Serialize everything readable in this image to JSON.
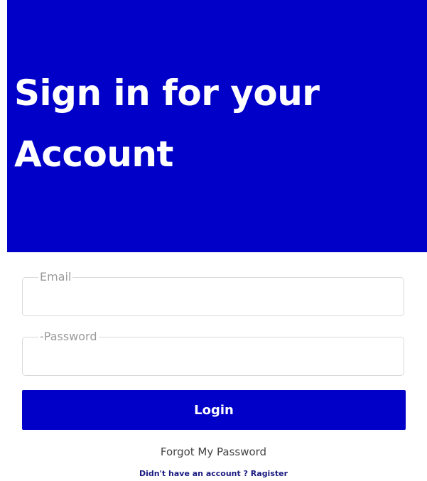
{
  "header": {
    "title_line1": "Sign in for your",
    "title_line2": "Account"
  },
  "form": {
    "email_label": "Email",
    "email_value": "",
    "password_label": "-Password",
    "password_value": "",
    "login_label": "Login"
  },
  "links": {
    "forgot_password": "Forgot My Password",
    "register": "Didn't have an account ? Ragister"
  },
  "colors": {
    "brand_blue": "#0000c8",
    "button_text": "#ffffff",
    "link_dark_blue": "#1a1a80"
  }
}
